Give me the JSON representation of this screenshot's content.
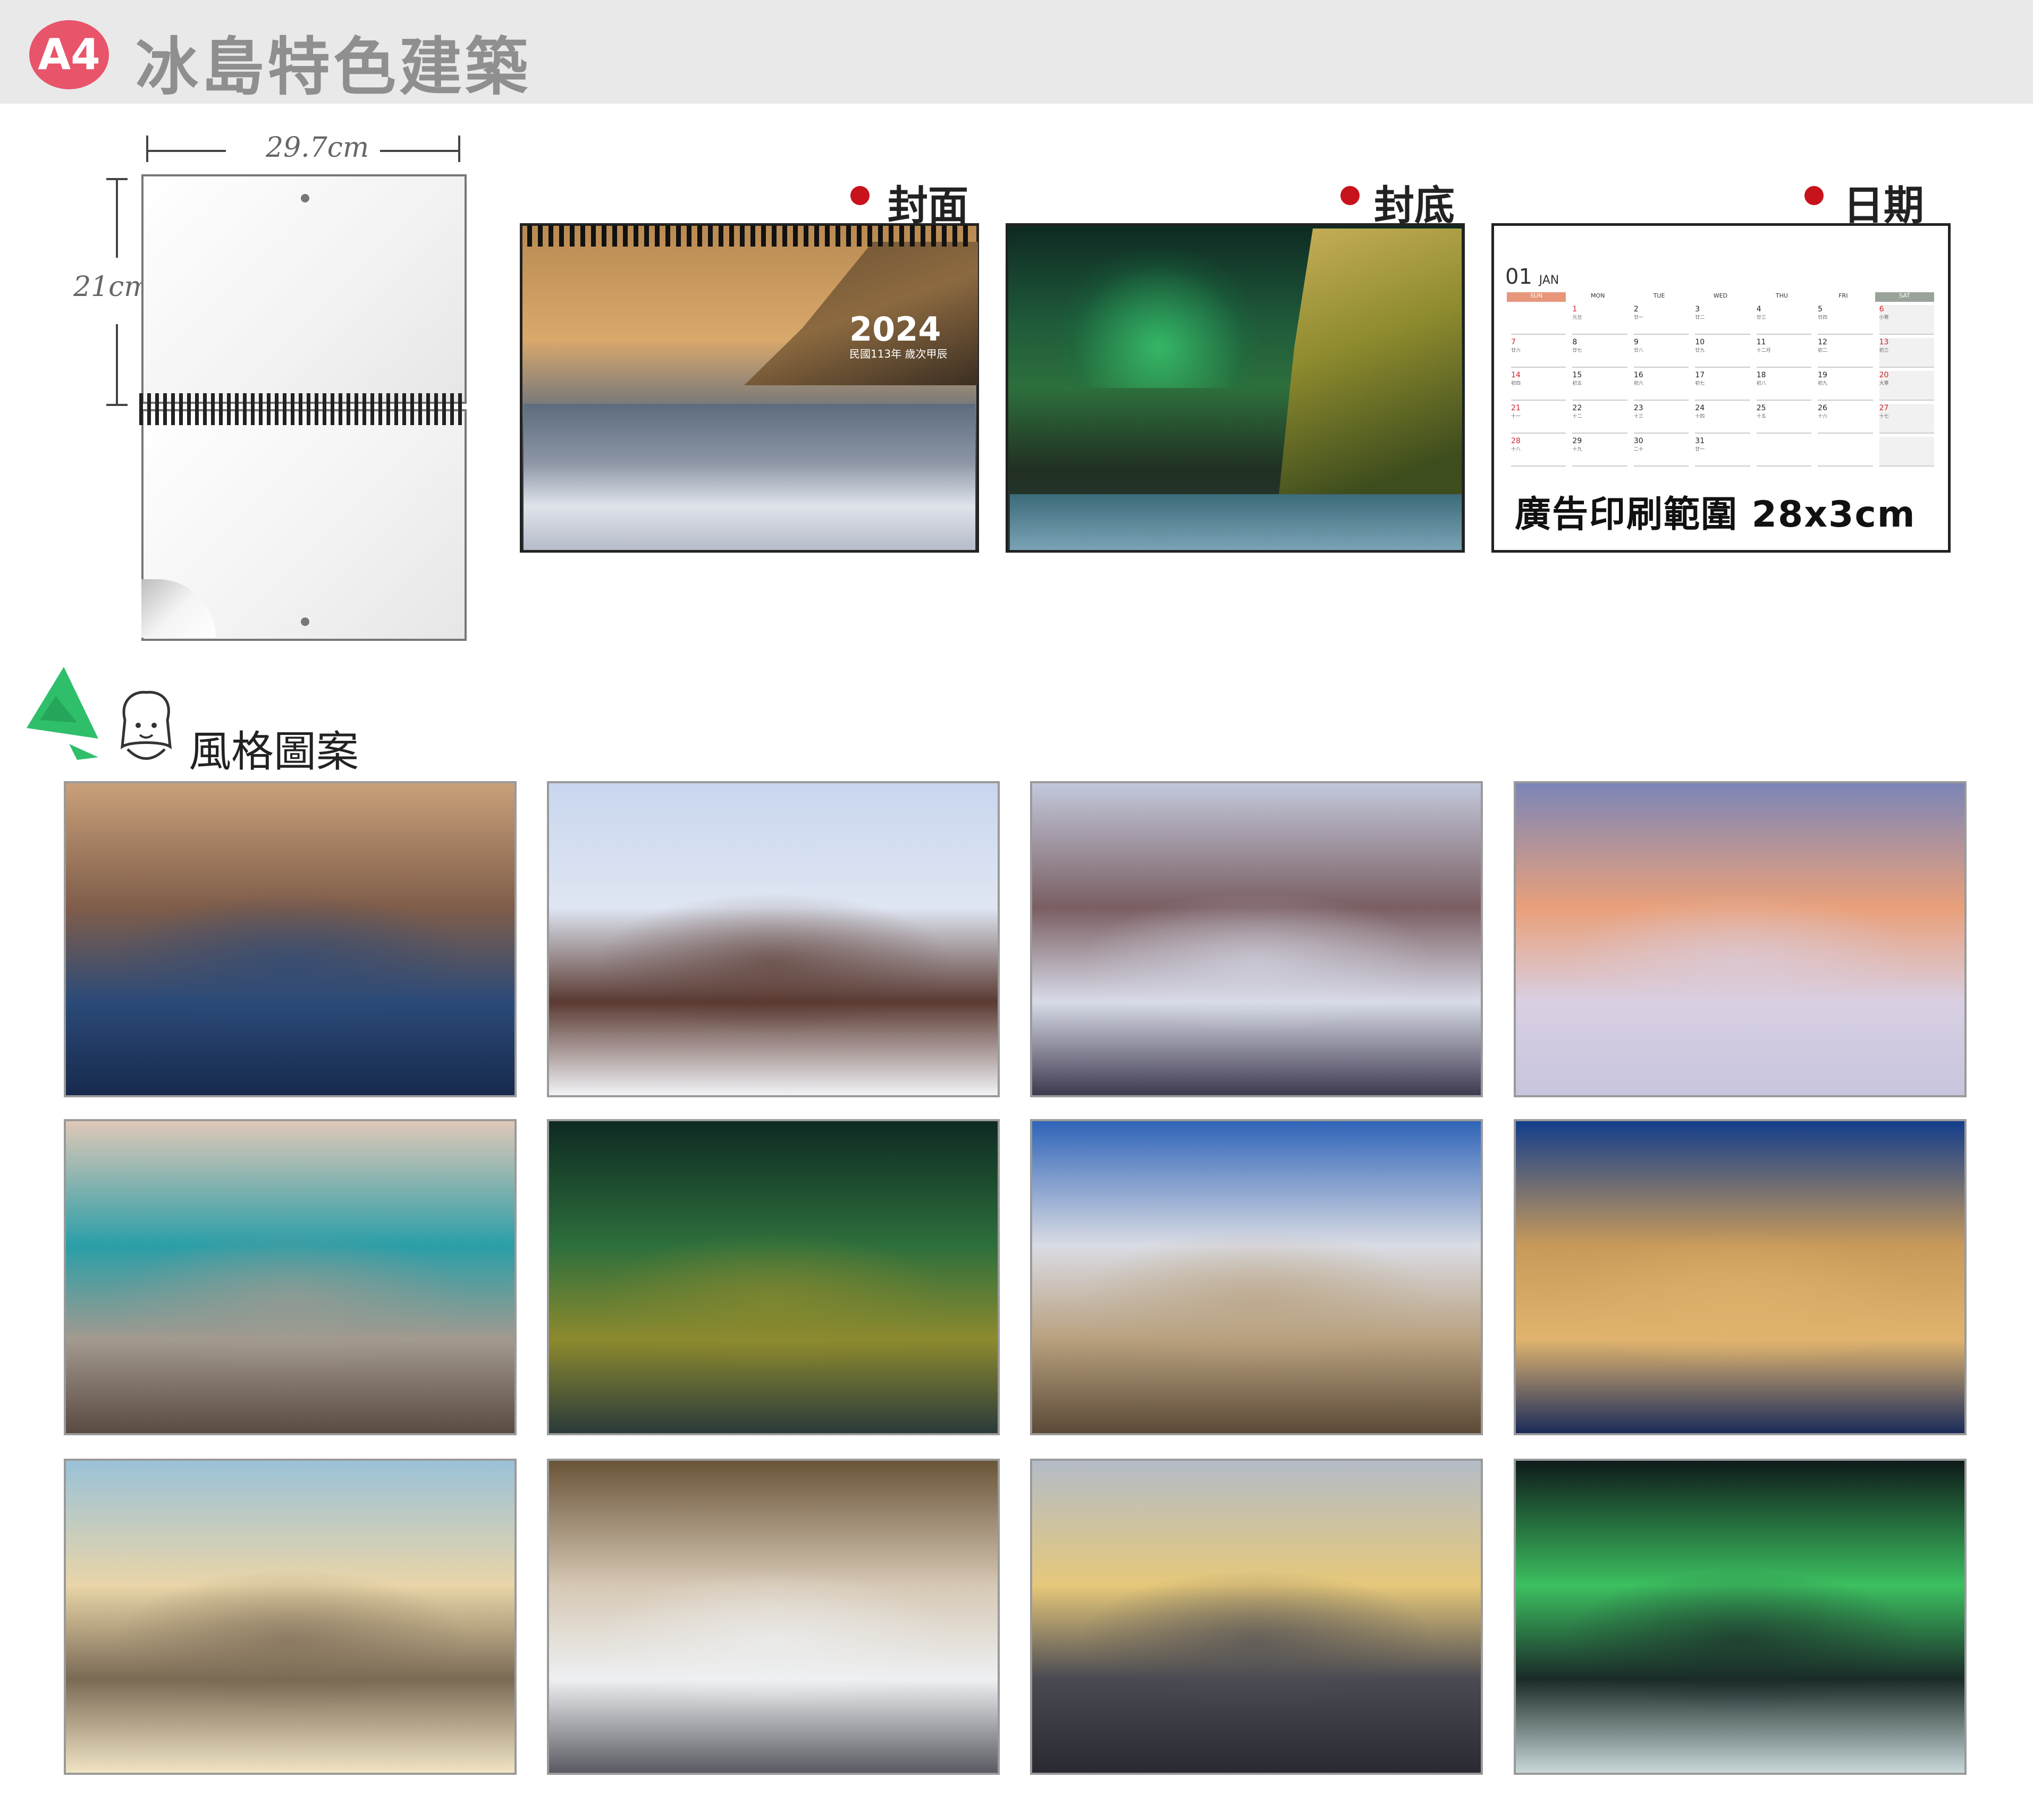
{
  "header": {
    "badge": "A4",
    "title": "冰島特色建築"
  },
  "diagram": {
    "width_label": "29.7cm",
    "height_label": "21cm"
  },
  "sections": {
    "cover_label": "封面",
    "back_label": "封底",
    "date_label": "日期"
  },
  "cover": {
    "year": "2024",
    "subtitle": "民國113年 歲次甲辰"
  },
  "calendar": {
    "month_num": "01",
    "month_name": "JAN",
    "days_of_week": [
      "SUN",
      "MON",
      "TUE",
      "WED",
      "THU",
      "FRI",
      "SAT"
    ],
    "weeks": [
      [
        {
          "d": "",
          "l": ""
        },
        {
          "d": "1",
          "l": "元旦"
        },
        {
          "d": "2",
          "l": "廿一"
        },
        {
          "d": "3",
          "l": "廿二"
        },
        {
          "d": "4",
          "l": "廿三"
        },
        {
          "d": "5",
          "l": "廿四"
        },
        {
          "d": "6",
          "l": "小寒"
        }
      ],
      [
        {
          "d": "7",
          "l": "廿六"
        },
        {
          "d": "8",
          "l": "廿七"
        },
        {
          "d": "9",
          "l": "廿八"
        },
        {
          "d": "10",
          "l": "廿九"
        },
        {
          "d": "11",
          "l": "十二月"
        },
        {
          "d": "12",
          "l": "初二"
        },
        {
          "d": "13",
          "l": "初三"
        }
      ],
      [
        {
          "d": "14",
          "l": "初四"
        },
        {
          "d": "15",
          "l": "初五"
        },
        {
          "d": "16",
          "l": "初六"
        },
        {
          "d": "17",
          "l": "初七"
        },
        {
          "d": "18",
          "l": "初八"
        },
        {
          "d": "19",
          "l": "初九"
        },
        {
          "d": "20",
          "l": "大寒"
        }
      ],
      [
        {
          "d": "21",
          "l": "十一"
        },
        {
          "d": "22",
          "l": "十二"
        },
        {
          "d": "23",
          "l": "十三"
        },
        {
          "d": "24",
          "l": "十四"
        },
        {
          "d": "25",
          "l": "十五"
        },
        {
          "d": "26",
          "l": "十六"
        },
        {
          "d": "27",
          "l": "十七"
        }
      ],
      [
        {
          "d": "28",
          "l": "十八"
        },
        {
          "d": "29",
          "l": "十九"
        },
        {
          "d": "30",
          "l": "二十"
        },
        {
          "d": "31",
          "l": "廿一"
        },
        {
          "d": "",
          "l": ""
        },
        {
          "d": "",
          "l": ""
        },
        {
          "d": "",
          "l": ""
        }
      ]
    ],
    "ad_text": "廣告印刷範圍 28x3cm",
    "colors": {
      "sun": "#e8967a",
      "sat": "#9aa39a",
      "holiday": "#d2232a"
    }
  },
  "style_section": {
    "label": "風格圖案"
  },
  "icons": {
    "badge": "a4-badge-icon",
    "bullet": "red-dot-icon",
    "tree": "christmas-tree-icon",
    "face": "girl-face-icon"
  },
  "thumbnails": [
    {
      "name": "harbor-swans",
      "colors": [
        "#c9a07a",
        "#7f5d4a",
        "#2b4a78",
        "#172a4d"
      ]
    },
    {
      "name": "snowy-farmhouse",
      "colors": [
        "#c9d6ef",
        "#dfe6f3",
        "#5a3a32",
        "#f2f2f6"
      ]
    },
    {
      "name": "snowy-valley",
      "colors": [
        "#c3c8dc",
        "#7a5e62",
        "#d8dbe8",
        "#3e3a4f"
      ]
    },
    {
      "name": "sunset-trees",
      "colors": [
        "#7c86b8",
        "#e9a07a",
        "#d9cfe2",
        "#c7c5de"
      ]
    },
    {
      "name": "turquoise-street",
      "colors": [
        "#dfc8b8",
        "#2a9ea7",
        "#a39a8f",
        "#5a4a42"
      ]
    },
    {
      "name": "aurora-forest",
      "colors": [
        "#0e2a22",
        "#2d6f3c",
        "#8d8a2e",
        "#2a3a3a"
      ]
    },
    {
      "name": "church-daylight",
      "colors": [
        "#2f64b8",
        "#dadce4",
        "#b8a07e",
        "#5c4a38"
      ]
    },
    {
      "name": "church-night",
      "colors": [
        "#133e8c",
        "#c89a5a",
        "#e0b46e",
        "#1a2b5a"
      ]
    },
    {
      "name": "harpa-interior",
      "colors": [
        "#9ac2d8",
        "#e9d5a8",
        "#7a6a55",
        "#f0e4c4"
      ]
    },
    {
      "name": "hillside-town",
      "colors": [
        "#6a5438",
        "#d6c8b4",
        "#eef0f2",
        "#5a5a62"
      ]
    },
    {
      "name": "harpa-hallway",
      "colors": [
        "#b4bcc8",
        "#e6c87a",
        "#4a4a52",
        "#2a2a32"
      ]
    },
    {
      "name": "aurora-night",
      "colors": [
        "#0e1a1a",
        "#3cc060",
        "#1a2a28",
        "#c8d8d8"
      ]
    }
  ]
}
